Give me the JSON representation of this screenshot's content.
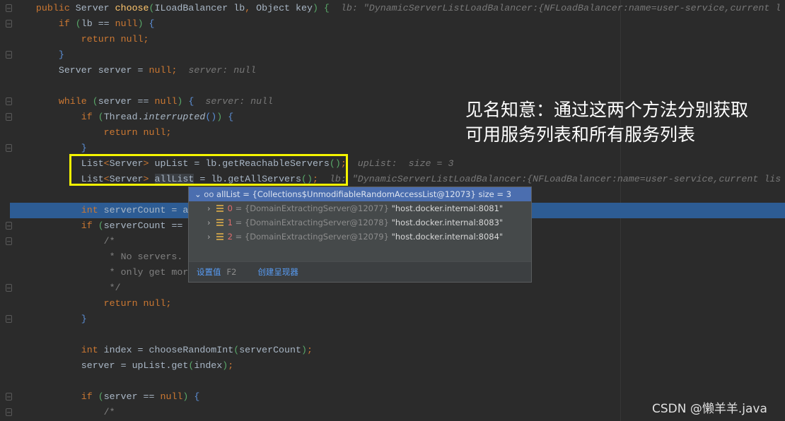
{
  "editor": {
    "lines": [
      [
        [
          "kw",
          "    public "
        ],
        [
          "tx",
          "Server "
        ],
        [
          "fn",
          "choose"
        ],
        [
          "pr",
          "("
        ],
        [
          "tx",
          "ILoadBalancer lb"
        ],
        [
          "pn",
          ", "
        ],
        [
          "tx",
          "Object key"
        ],
        [
          "pr",
          ") "
        ],
        [
          "pr",
          "{"
        ],
        [
          "hint",
          "  lb: \"DynamicServerListLoadBalancer:{NFLoadBalancer:name=user-service,current l"
        ]
      ],
      [
        [
          "kw",
          "        if "
        ],
        [
          "pr",
          "("
        ],
        [
          "tx",
          "lb == "
        ],
        [
          "kw",
          "null"
        ],
        [
          "pr",
          ") "
        ],
        [
          "br",
          "{"
        ]
      ],
      [
        [
          "kw",
          "            return null"
        ],
        [
          "pn",
          ";"
        ]
      ],
      [
        [
          "br",
          "        }"
        ]
      ],
      [
        [
          "tx",
          "        Server server = "
        ],
        [
          "kw",
          "null"
        ],
        [
          "pn",
          ";"
        ],
        [
          "hint",
          "  server: null"
        ]
      ],
      [],
      [
        [
          "kw",
          "        while "
        ],
        [
          "pr",
          "("
        ],
        [
          "tx",
          "server == "
        ],
        [
          "kw",
          "null"
        ],
        [
          "pr",
          ") "
        ],
        [
          "br",
          "{"
        ],
        [
          "hint",
          "  server: null"
        ]
      ],
      [
        [
          "kw",
          "            if "
        ],
        [
          "pr",
          "("
        ],
        [
          "tx",
          "Thread."
        ],
        [
          "it",
          "interrupted"
        ],
        [
          "br",
          "()"
        ],
        [
          "pr",
          ") "
        ],
        [
          "br",
          "{"
        ]
      ],
      [
        [
          "kw",
          "                return null"
        ],
        [
          "pn",
          ";"
        ]
      ],
      [
        [
          "br",
          "            }"
        ]
      ],
      [
        [
          "tx",
          "            List"
        ],
        [
          "pn",
          "<"
        ],
        [
          "tx",
          "Server"
        ],
        [
          "pn",
          "> "
        ],
        [
          "tx",
          "upList = lb.getReachableServers"
        ],
        [
          "pr",
          "()"
        ],
        [
          "pn",
          ";"
        ],
        [
          "hint",
          "  upList:  size = 3"
        ]
      ],
      [
        [
          "tx",
          "            List"
        ],
        [
          "pn",
          "<"
        ],
        [
          "tx",
          "Server"
        ],
        [
          "pn",
          "> "
        ],
        [
          "sel",
          "allList"
        ],
        [
          "tx",
          " = lb.getAllServers"
        ],
        [
          "pr",
          "()"
        ],
        [
          "pn",
          ";"
        ],
        [
          "hint",
          "  lb: \"DynamicServerListLoadBalancer:{NFLoadBalancer:name=user-service,current lis"
        ]
      ],
      [],
      [
        [
          "kw",
          "            int "
        ],
        [
          "tx",
          "serverCount = a"
        ]
      ],
      [
        [
          "kw",
          "            if "
        ],
        [
          "pr",
          "("
        ],
        [
          "tx",
          "serverCount == "
        ]
      ],
      [
        [
          "cmt",
          "                /*"
        ]
      ],
      [
        [
          "cmt",
          "                 * No servers."
        ]
      ],
      [
        [
          "cmt",
          "                 * only get mor"
        ]
      ],
      [
        [
          "cmt",
          "                 */"
        ]
      ],
      [
        [
          "kw",
          "                return null"
        ],
        [
          "pn",
          ";"
        ]
      ],
      [
        [
          "br",
          "            }"
        ]
      ],
      [],
      [
        [
          "kw",
          "            int "
        ],
        [
          "tx",
          "index = chooseRandomInt"
        ],
        [
          "pr",
          "("
        ],
        [
          "tx",
          "serverCount"
        ],
        [
          "pr",
          ")"
        ],
        [
          "pn",
          ";"
        ]
      ],
      [
        [
          "tx",
          "            server = upList.get"
        ],
        [
          "pr",
          "("
        ],
        [
          "tx",
          "index"
        ],
        [
          "pr",
          ")"
        ],
        [
          "pn",
          ";"
        ]
      ],
      [],
      [
        [
          "kw",
          "            if "
        ],
        [
          "pr",
          "("
        ],
        [
          "tx",
          "server == "
        ],
        [
          "kw",
          "null"
        ],
        [
          "pr",
          ") "
        ],
        [
          "br",
          "{"
        ]
      ],
      [
        [
          "cmt",
          "                /*"
        ]
      ]
    ],
    "current_line": 13
  },
  "debug_popup": {
    "header": "allList = {Collections$UnmodifiableRandomAccessList@12073}  size = 3",
    "items": [
      {
        "index": "0",
        "type": "{DomainExtractingServer@12077}",
        "value": "\"host.docker.internal:8081\""
      },
      {
        "index": "1",
        "type": "{DomainExtractingServer@12078}",
        "value": "\"host.docker.internal:8083\""
      },
      {
        "index": "2",
        "type": "{DomainExtractingServer@12079}",
        "value": "\"host.docker.internal:8084\""
      }
    ],
    "set_value_label": "设置值",
    "set_value_key": "F2",
    "create_renderer_label": "创建呈现器"
  },
  "annotation": {
    "line1": "见名知意：通过这两个方法分别获取",
    "line2": "可用服务列表和所有服务列表"
  },
  "watermark": "CSDN @懒羊羊.java",
  "colors": {
    "highlight_box": "#f5f500",
    "current_line": "#2d5c94",
    "popup_header": "#4b6eaf"
  }
}
